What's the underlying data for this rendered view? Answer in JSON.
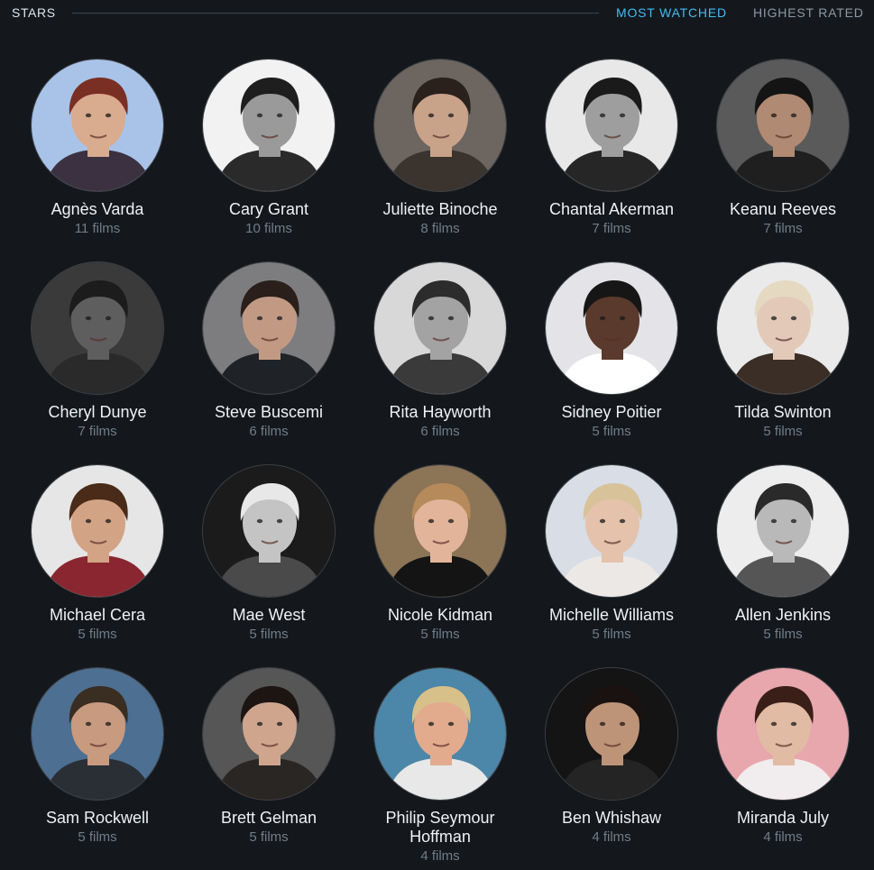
{
  "header": {
    "title": "STARS",
    "sort_options": [
      "MOST WATCHED",
      "HIGHEST RATED"
    ],
    "active_sort": "MOST WATCHED"
  },
  "colors": {
    "background": "#14181c",
    "accent": "#40bcf4",
    "muted": "#8b98a6"
  },
  "stars": [
    {
      "name": "Agnès Varda",
      "count": "11 films",
      "bg": "#a9c3e8",
      "skin": "#d9ab8f",
      "hair": "#7a2f24",
      "shirt": "#3b3140"
    },
    {
      "name": "Cary Grant",
      "count": "10 films",
      "bg": "#f2f2f2",
      "skin": "#9a9a9a",
      "hair": "#1e1e1e",
      "shirt": "#2a2a2a"
    },
    {
      "name": "Juliette Binoche",
      "count": "8 films",
      "bg": "#6c6560",
      "skin": "#c9a28a",
      "hair": "#2a211c",
      "shirt": "#3a332e"
    },
    {
      "name": "Chantal Akerman",
      "count": "7 films",
      "bg": "#e8e8e8",
      "skin": "#9e9e9e",
      "hair": "#1a1a1a",
      "shirt": "#262626"
    },
    {
      "name": "Keanu Reeves",
      "count": "7 films",
      "bg": "#5a5a5a",
      "skin": "#b08a72",
      "hair": "#141414",
      "shirt": "#1f1f1f"
    },
    {
      "name": "Cheryl Dunye",
      "count": "7 films",
      "bg": "#3a3a3a",
      "skin": "#5e5e5e",
      "hair": "#1c1c1c",
      "shirt": "#2a2a2a"
    },
    {
      "name": "Steve Buscemi",
      "count": "6 films",
      "bg": "#7d7d80",
      "skin": "#c29a84",
      "hair": "#2a1f1a",
      "shirt": "#1f2328"
    },
    {
      "name": "Rita Hayworth",
      "count": "6 films",
      "bg": "#d8d8d8",
      "skin": "#a3a3a3",
      "hair": "#2c2c2c",
      "shirt": "#3a3a3a"
    },
    {
      "name": "Sidney Poitier",
      "count": "5 films",
      "bg": "#e4e4e8",
      "skin": "#5a3a2c",
      "hair": "#161616",
      "shirt": "#ffffff"
    },
    {
      "name": "Tilda Swinton",
      "count": "5 films",
      "bg": "#eaeaea",
      "skin": "#e3c9b8",
      "hair": "#e6d9c2",
      "shirt": "#3b2e26"
    },
    {
      "name": "Michael Cera",
      "count": "5 films",
      "bg": "#e6e6e6",
      "skin": "#d3a386",
      "hair": "#4a2a18",
      "shirt": "#8a2630"
    },
    {
      "name": "Mae West",
      "count": "5 films",
      "bg": "#1b1b1b",
      "skin": "#c4c4c4",
      "hair": "#e8e8e8",
      "shirt": "#4a4a4a"
    },
    {
      "name": "Nicole Kidman",
      "count": "5 films",
      "bg": "#8c7456",
      "skin": "#e2b49a",
      "hair": "#b68a5a",
      "shirt": "#141414"
    },
    {
      "name": "Michelle Williams",
      "count": "5 films",
      "bg": "#d8dde6",
      "skin": "#e5c2ac",
      "hair": "#d8c29a",
      "shirt": "#ece8e6"
    },
    {
      "name": "Allen Jenkins",
      "count": "5 films",
      "bg": "#ededed",
      "skin": "#b9b9b9",
      "hair": "#2a2a2a",
      "shirt": "#555555"
    },
    {
      "name": "Sam Rockwell",
      "count": "5 films",
      "bg": "#4d6f92",
      "skin": "#c89a80",
      "hair": "#3a2d22",
      "shirt": "#2a2f36"
    },
    {
      "name": "Brett Gelman",
      "count": "5 films",
      "bg": "#565656",
      "skin": "#d0a58d",
      "hair": "#1c1512",
      "shirt": "#2a2624"
    },
    {
      "name": "Philip Seymour Hoffman",
      "count": "4 films",
      "bg": "#4c86a8",
      "skin": "#e2ab8e",
      "hair": "#d8c08a",
      "shirt": "#e8e8e8"
    },
    {
      "name": "Ben Whishaw",
      "count": "4 films",
      "bg": "#141414",
      "skin": "#bd9478",
      "hair": "#1a1210",
      "shirt": "#242424"
    },
    {
      "name": "Miranda July",
      "count": "4 films",
      "bg": "#e8a6ad",
      "skin": "#e2bba4",
      "hair": "#3a1f18",
      "shirt": "#f1ecee"
    }
  ]
}
